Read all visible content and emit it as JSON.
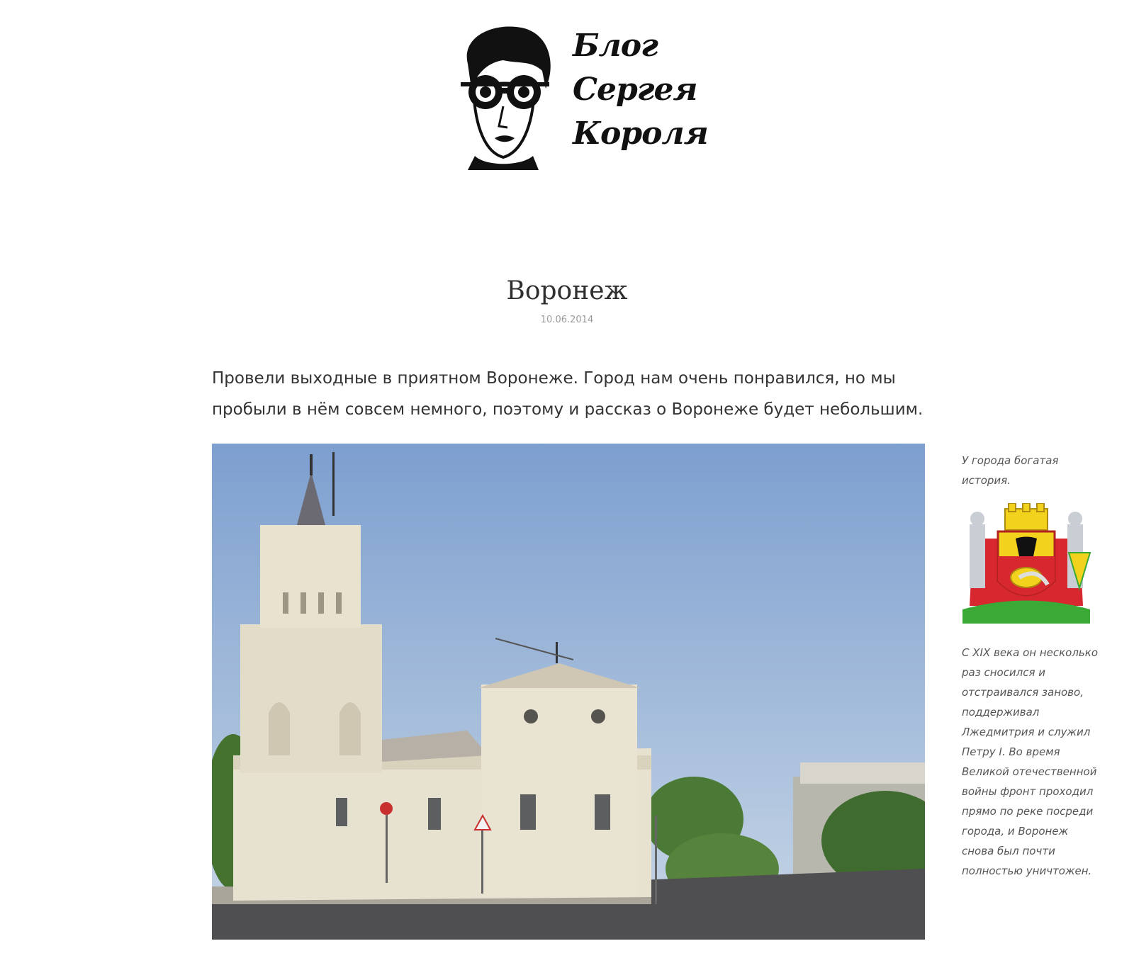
{
  "header": {
    "logo_text_lines": [
      "Блог",
      "Сергея",
      "Короля"
    ],
    "logo_icon": "goggles-portrait-icon"
  },
  "post": {
    "title": "Воронеж",
    "date": "10.06.2014",
    "lead": "Провели выходные в приятном Воронеже. Город нам очень понравился, но мы пробыли в нём совсем немного, поэтому и рассказ о Воронеже будет небольшим.",
    "photo_subject": "old-building-with-tower-photo"
  },
  "sidenote": {
    "caption_top": "У города богатая история.",
    "coat_of_arms_icon": "voronezh-coat-of-arms-icon",
    "caption_bottom": "С XIX века он несколько раз сносился и отстраивался заново, поддерживал Лжедмитрия и служил Петру I. Во время Великой отечественной войны фронт проходил прямо по реке посреди города, и Воронеж снова был почти полностью уничтожен."
  },
  "colors": {
    "sky_top": "#7d9fcf",
    "sky_bottom": "#c7d6e6",
    "building": "#e7e1cf",
    "coat_red": "#d7282f",
    "coat_yellow": "#f2d21c",
    "coat_green": "#3aa935"
  }
}
